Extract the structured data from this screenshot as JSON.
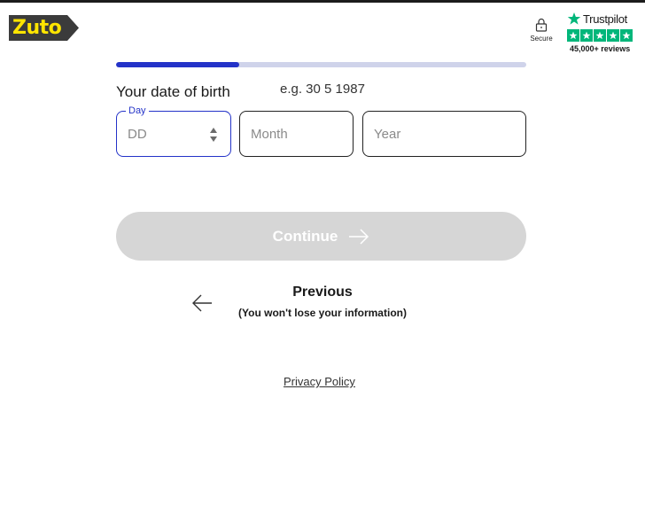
{
  "header": {
    "logo_text": "Zuto",
    "secure_label": "Secure",
    "trustpilot": {
      "name": "Trustpilot",
      "rating_stars": 5,
      "reviews": "45,000+ reviews"
    }
  },
  "progress": {
    "fraction": 0.3
  },
  "form": {
    "dob_label": "Your date of birth",
    "example": "e.g. 30 5 1987",
    "day": {
      "label": "Day",
      "placeholder": "DD",
      "value": ""
    },
    "month": {
      "placeholder": "Month",
      "value": ""
    },
    "year": {
      "placeholder": "Year",
      "value": ""
    }
  },
  "actions": {
    "continue_label": "Continue",
    "previous_title": "Previous",
    "previous_subtitle": "(You won't lose your information)"
  },
  "footer": {
    "privacy_link": "Privacy Policy"
  },
  "colors": {
    "brand_yellow": "#ffe500",
    "logo_bg": "#3b3b3b",
    "accent_blue": "#2433c8",
    "progress_track": "#cfd3ea",
    "trustpilot_green": "#00b67a",
    "disabled_button": "#d6d6d6"
  },
  "icons": [
    "lock-icon",
    "trustpilot-star-icon",
    "arrow-right-icon",
    "arrow-left-icon",
    "spinner-arrows-icon"
  ]
}
